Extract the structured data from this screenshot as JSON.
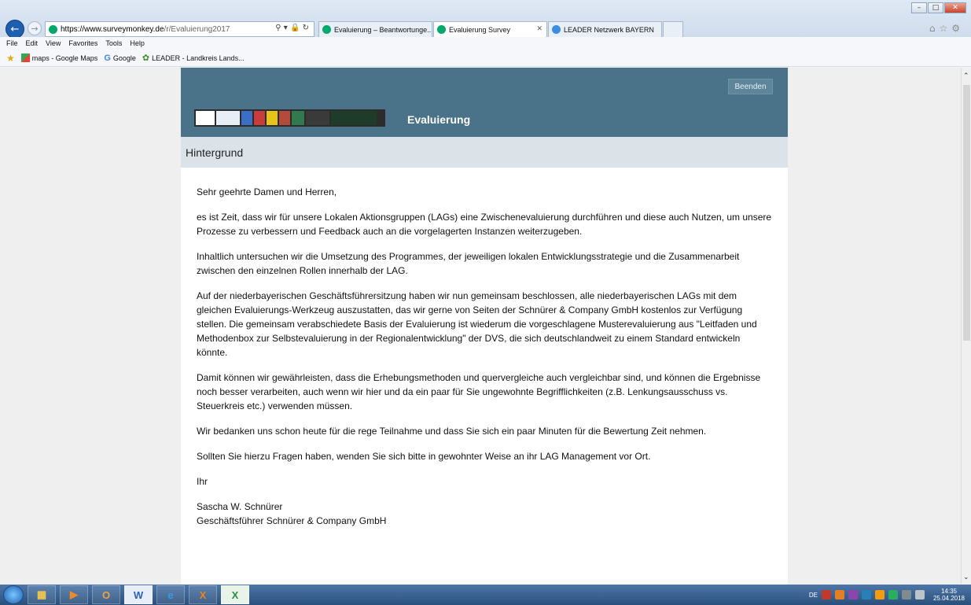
{
  "browser": {
    "address": {
      "host": "https://www.surveymonkey.de",
      "path": "/r/Evaluierung2017"
    },
    "tabs": [
      {
        "label": "Evaluierung – Beantwortunge..."
      },
      {
        "label": "Evaluierung Survey"
      },
      {
        "label": "LEADER Netzwerk BAYERN"
      }
    ],
    "menu": [
      "File",
      "Edit",
      "View",
      "Favorites",
      "Tools",
      "Help"
    ],
    "favorites": [
      "maps - Google Maps",
      "Google",
      "LEADER - Landkreis Lands..."
    ]
  },
  "survey": {
    "exit_label": "Beenden",
    "title": "Evaluierung",
    "page_title": "Hintergrund",
    "paragraphs": [
      "Sehr geehrte Damen und Herren,",
      "es ist Zeit, dass wir für unsere Lokalen Aktionsgruppen (LAGs) eine Zwischenevaluierung durchführen und diese auch Nutzen, um unsere Prozesse zu verbessern und Feedback auch an die vorgelagerten Instanzen weiterzugeben.",
      "Inhaltlich untersuchen wir die Umsetzung des Programmes, der jeweiligen lokalen Entwicklungsstrategie und die Zusammenarbeit zwischen den einzelnen Rollen innerhalb der LAG.",
      "Auf der niederbayerischen Geschäftsführersitzung haben wir nun gemeinsam beschlossen, alle niederbayerischen LAGs mit dem gleichen Evaluierungs-Werkzeug auszustatten, das wir gerne von Seiten der Schnürer & Company GmbH kostenlos zur Verfügung stellen. Die gemeinsam verabschiedete Basis der Evaluierung ist wiederum die vorgeschlagene Musterevaluierung aus \"Leitfaden und Methodenbox zur Selbstevaluierung in der Regionalentwicklung\" der DVS, die sich deutschlandweit zu einem Standard entwickeln könnte.",
      "Damit können wir gewährleisten, dass die Erhebungsmethoden und quervergleiche auch vergleichbar sind, und können die Ergebnisse noch besser verarbeiten, auch wenn wir hier und da ein paar für Sie ungewohnte Begrifflichkeiten (z.B. Lenkungsausschuss vs. Steuerkreis etc.) verwenden müssen.",
      "Wir bedanken uns schon heute für die rege Teilnahme und dass Sie sich ein paar Minuten für die Bewertung Zeit nehmen.",
      "Sollten Sie hierzu Fragen haben, wenden Sie sich bitte in gewohnter Weise an ihr LAG Management vor Ort.",
      "Ihr"
    ],
    "signature_name": "Sascha W. Schnürer",
    "signature_role": "Geschäftsführer Schnürer & Company GmbH"
  },
  "taskbar": {
    "language": "DE",
    "time": "14:35",
    "date": "25.04.2018"
  },
  "colors": {
    "header": "#4a7288",
    "page_bar": "#dbe3e9"
  }
}
